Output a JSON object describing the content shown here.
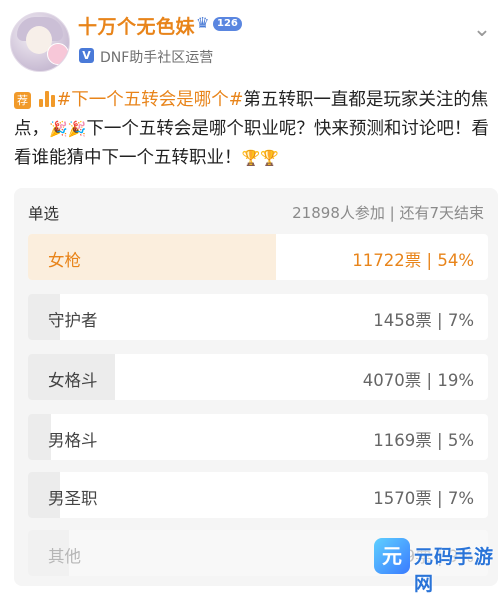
{
  "user": {
    "nickname": "十万个无色妹",
    "vip_level": "126",
    "verify_mark": "V",
    "verify_text": "DNF助手社区运营"
  },
  "post": {
    "badge": "荐",
    "topic": "#下一个五转会是哪个#",
    "text1": "第五转职一直都是玩家关注的焦点，",
    "text2": "下一个五转会是哪个职业呢？快来预测和讨论吧！看看谁能猜中下一个五转职业！"
  },
  "poll": {
    "type": "单选",
    "stats": "21898人参加 | 还有7天结束",
    "options": [
      {
        "label": "女枪",
        "result": "11722票 | 54%",
        "percent": 54
      },
      {
        "label": "守护者",
        "result": "1458票 | 7%",
        "percent": 7
      },
      {
        "label": "女格斗",
        "result": "4070票 | 19%",
        "percent": 19
      },
      {
        "label": "男格斗",
        "result": "1169票 | 5%",
        "percent": 5
      },
      {
        "label": "男圣职",
        "result": "1570票 | 7%",
        "percent": 7
      },
      {
        "label": "其他",
        "result": "1909票 | 9%",
        "percent": 9
      }
    ]
  },
  "watermark": {
    "logo": "元",
    "text": "元码手游网"
  },
  "colors": {
    "accent": "#e8841a",
    "verify": "#4a7ad8",
    "poll_bg": "#f5f5f5"
  }
}
